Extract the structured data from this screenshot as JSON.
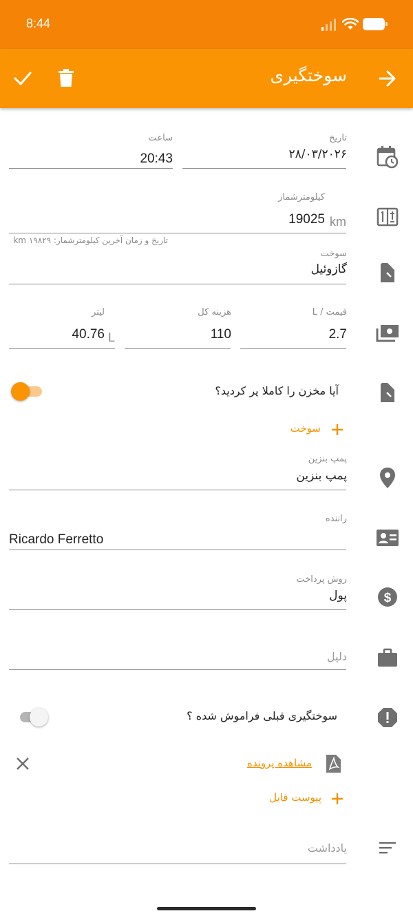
{
  "status_bar": {
    "time": "8:44"
  },
  "header": {
    "title": "سوختگیری"
  },
  "date_field": {
    "label": "تاریخ",
    "value": "۲۸/۰۳/۲۰۲۶"
  },
  "time_field": {
    "label": "ساعت",
    "value": "20:43"
  },
  "odometer": {
    "label": "کیلومترشمار",
    "value": "19025",
    "unit": "km",
    "hint": "تاریخ و زمان آخرین کیلومترشمار: ۱۹۸۲۹ km"
  },
  "fuel_type": {
    "label": "سوخت",
    "value": "گازوئیل"
  },
  "price_per_liter": {
    "label": "قیمت / L",
    "value": "2.7"
  },
  "total_cost": {
    "label": "هزینه کل",
    "value": "110"
  },
  "liters": {
    "label": "لیتر",
    "value": "40.76",
    "unit": "L"
  },
  "full_tank": {
    "question": "آیا مخزن را کاملا پر کردید؟",
    "on": true
  },
  "add_fuel": {
    "label": "سوخت"
  },
  "gas_station": {
    "label": "پمپ بنزین",
    "value": "پمپ بنزین"
  },
  "driver": {
    "label": "راننده",
    "value": "Ricardo Ferretto"
  },
  "payment_method": {
    "label": "روش پرداخت",
    "value": "پول"
  },
  "reason": {
    "placeholder": "دلیل"
  },
  "missed_refuel": {
    "question": "سوختگیری قبلی فراموش شده ؟",
    "on": false
  },
  "attachment": {
    "view_label": "مشاهده پرونده",
    "attach_label": "پیوست فایل"
  },
  "note": {
    "placeholder": "یادداشت"
  },
  "colors": {
    "accent": "#FA9403",
    "status": "#F58306",
    "icon_gray": "#6f6f6f"
  },
  "icons": [
    "check-icon",
    "trash-icon",
    "arrow-right-icon",
    "calendar-clock-icon",
    "odometer-icon",
    "fuel-can-icon",
    "money-icon",
    "location-pin-icon",
    "id-card-icon",
    "dollar-icon",
    "briefcase-icon",
    "alert-icon",
    "pdf-icon",
    "close-icon",
    "plus-icon",
    "notes-icon"
  ]
}
